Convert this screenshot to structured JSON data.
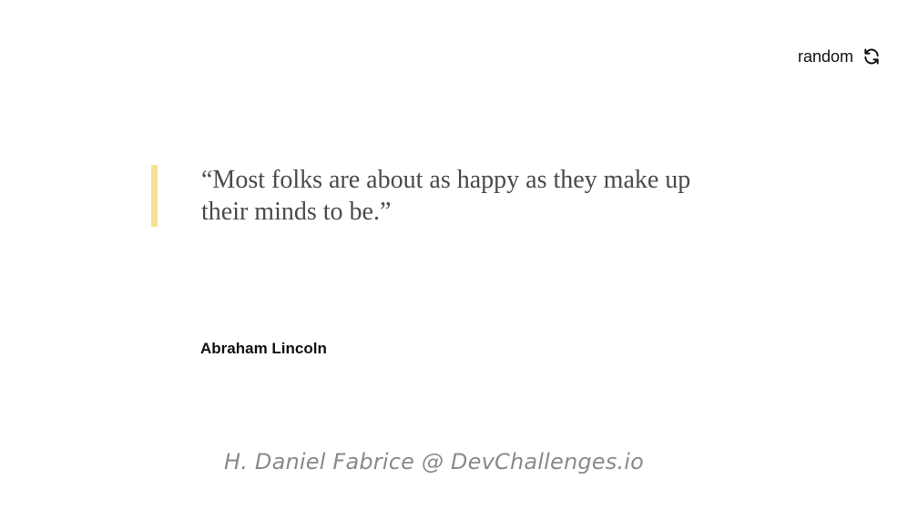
{
  "header": {
    "random_label": "random",
    "random_icon": "refresh-icon"
  },
  "quote": {
    "text": "“Most folks are about as happy as they make up their minds to be.”",
    "accent_color": "#f7df94"
  },
  "author": {
    "name": "Abraham Lincoln"
  },
  "footer": {
    "credit": "H. Daniel Fabrice @ DevChallenges.io"
  }
}
